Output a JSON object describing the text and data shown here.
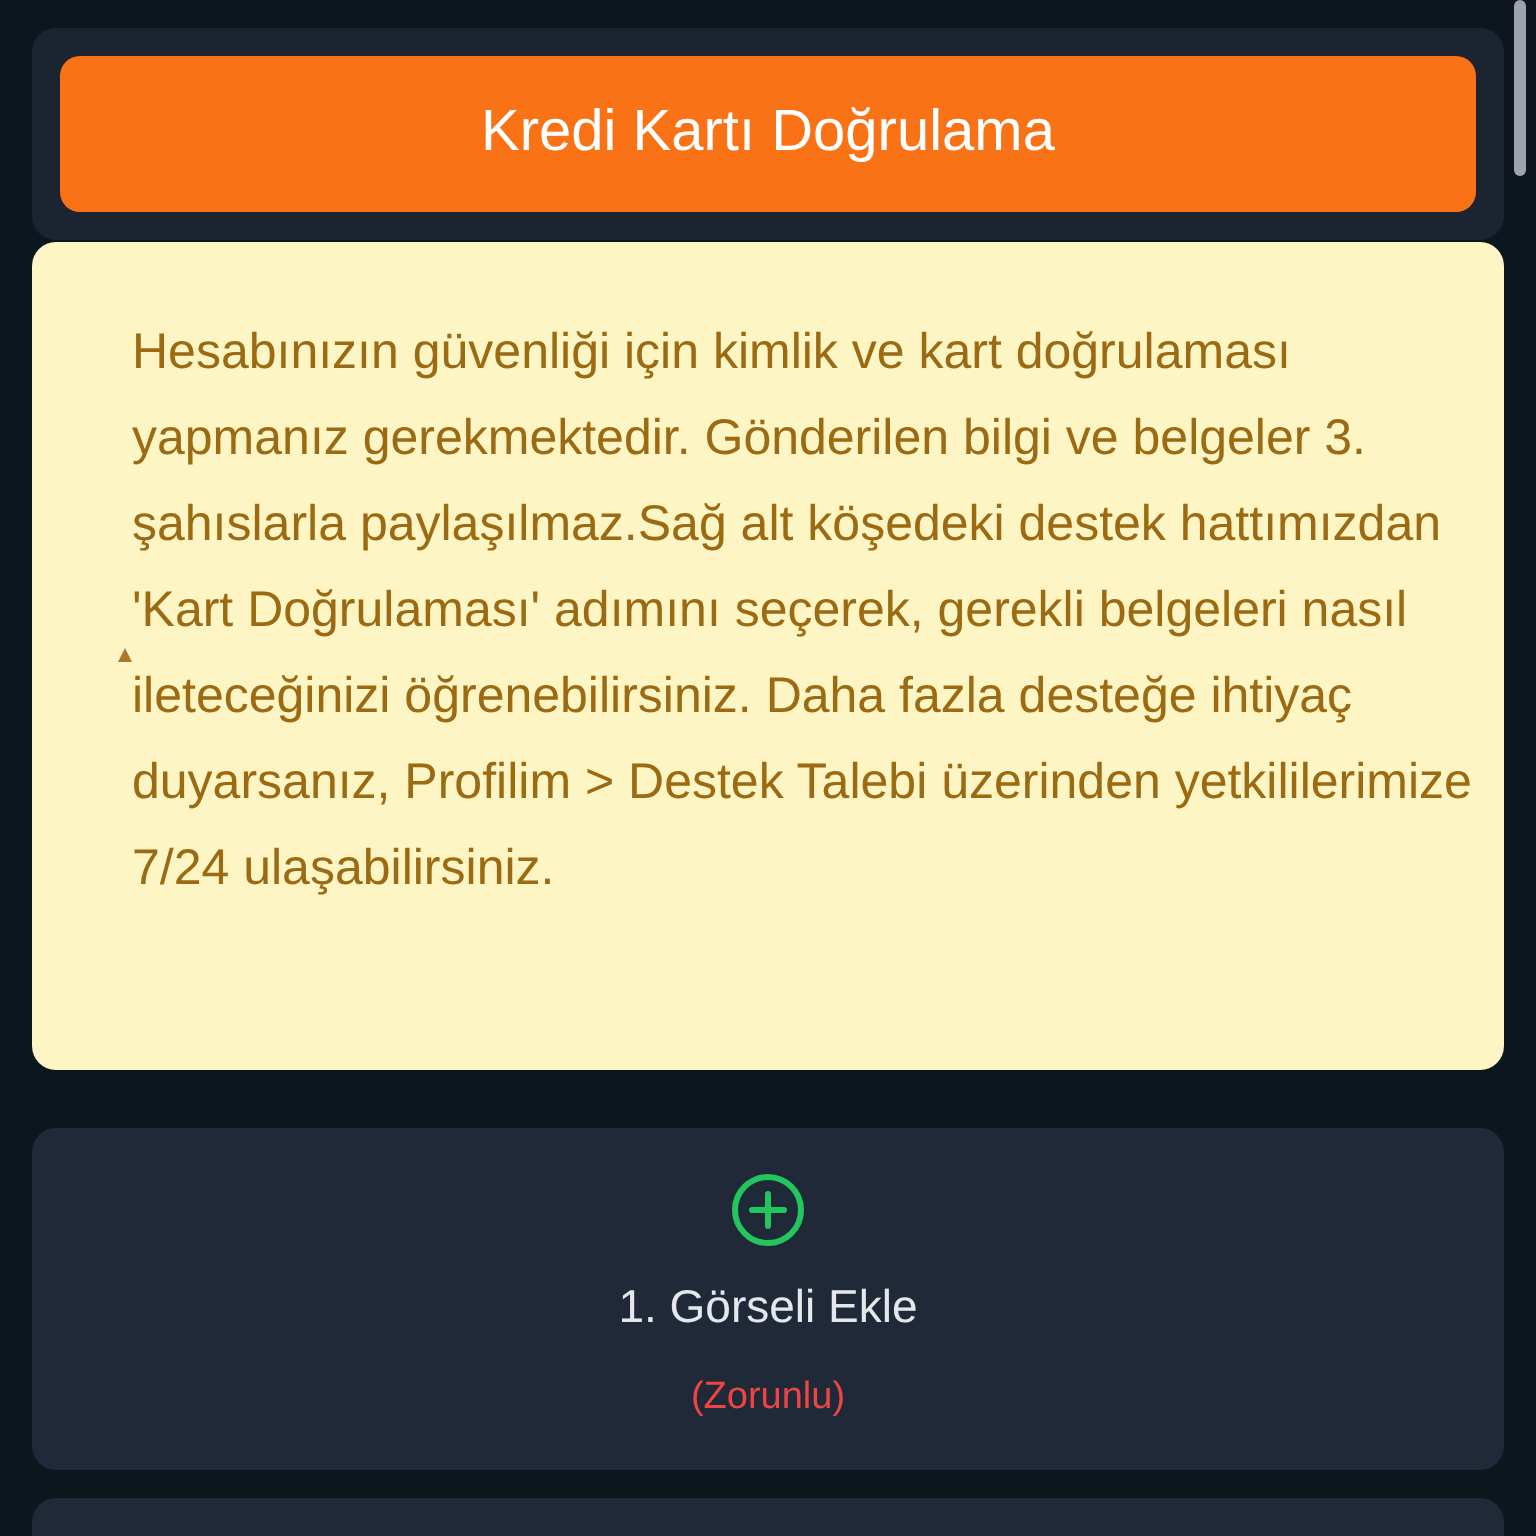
{
  "header": {
    "title": "Kredi Kartı Doğrulama"
  },
  "notice": {
    "text": "Hesabınızın güvenliği için kimlik ve kart doğrulaması yapmanız gerekmektedir. Gönderilen bilgi ve belgeler 3. şahıslarla paylaşılmaz.Sağ alt köşedeki destek hattımızdan 'Kart Doğrulaması' adımını seçerek, gerekli belgeleri nasıl ileteceğinizi öğrenebilirsiniz. Daha fazla desteğe ihtiyaç duyarsanız, Profilim > Destek Talebi üzerinden yetkililerimize 7/24 ulaşabilirsiniz."
  },
  "uploads": [
    {
      "label": "1. Görseli Ekle",
      "note": "(Zorunlu)"
    }
  ]
}
